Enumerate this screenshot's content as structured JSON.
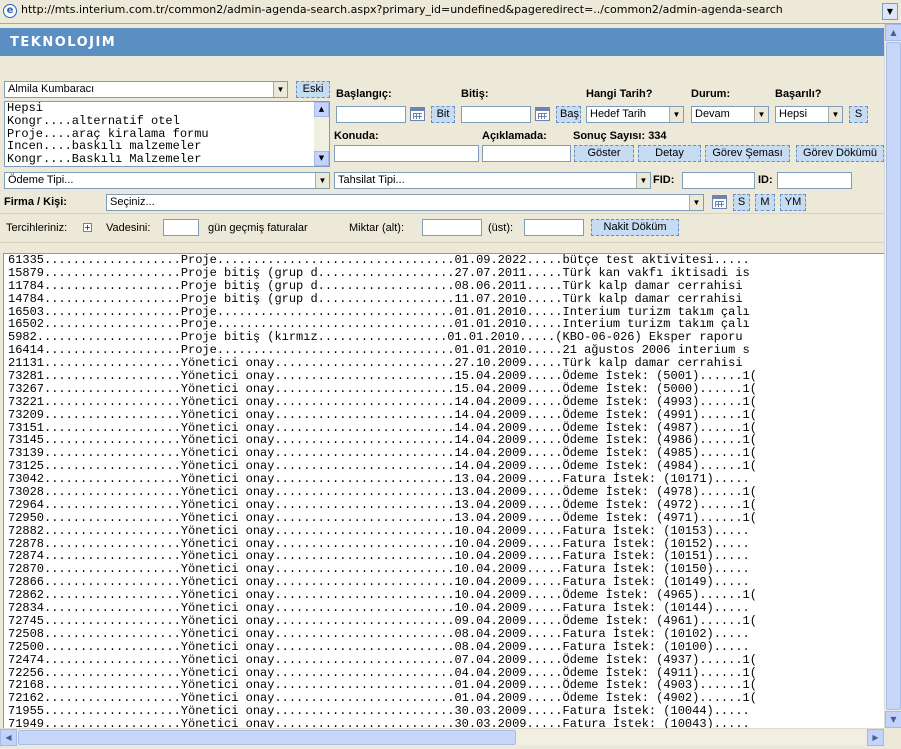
{
  "browser": {
    "url": "http://mts.interium.com.tr/common2/admin-agenda-search.aspx?primary_id=undefined&pageredirect=../common2/admin-agenda-search"
  },
  "brand": {
    "logo": "TEKNOLOJIM"
  },
  "filters": {
    "user_select": "Almila Kumbaracı",
    "eski_button": "Eski",
    "list_items": [
      "Hepsi",
      "Kongr....alternatif otel",
      "Proje....araç kiralama formu",
      "Incen....baskılı malzemeler",
      "Kongr....Baskılı Malzemeler"
    ],
    "baslangic_label": "Başlangıç:",
    "bit_button": "Bit",
    "bitis_label": "Bitiş:",
    "bas_button": "Baş",
    "hangi_tarih_label": "Hangi Tarih?",
    "hangi_tarih_value": "Hedef Tarih",
    "durum_label": "Durum:",
    "durum_value": "Devam",
    "basarili_label": "Başarılı?",
    "basarili_value": "Hepsi",
    "s_button": "S",
    "konuda_label": "Konuda:",
    "aciklamada_label": "Açıklamada:",
    "sonuc_label": "Sonuç Sayısı: 334",
    "goster_button": "Göster",
    "detay_button": "Detay",
    "gorev_semasi_button": "Görev Şeması",
    "gorev_dokumu_button": "Görev Dökümü",
    "odeme_tipi": "Ödeme Tipi...",
    "tahsilat_tipi": "Tahsilat Tipi...",
    "fid_label": "FID:",
    "id_label": "ID:",
    "firma_label": "Firma / Kişi:",
    "firma_value": "Seçiniz...",
    "s2_button": "S",
    "m_button": "M",
    "ym_button": "YM",
    "tercihleriniz_label": "Tercihleriniz:",
    "vadesini_label": "Vadesini:",
    "gecmis_label": "gün geçmiş faturalar",
    "miktar_alt_label": "Miktar (alt):",
    "ust_label": "(üst):",
    "nakit_button": "Nakit Döküm"
  },
  "results": [
    "61335...................Proje.................................01.09.2022.....bütçe test aktivitesi.....",
    "15879...................Proje bitiş (grup d...................27.07.2011.....Türk kan vakfı iktisadi is",
    "11784...................Proje bitiş (grup d...................08.06.2011.....Türk kalp damar cerrahisi",
    "14784...................Proje bitiş (grup d...................11.07.2010.....Türk kalp damar cerrahisi",
    "16503...................Proje.................................01.01.2010.....Interium turizm takım çalı",
    "16502...................Proje.................................01.01.2010.....Interium turizm takım çalı",
    "5982....................Proje bitiş (kırmız..................01.01.2010.....(KBO-06-026) Eksper raporu",
    "16414...................Proje.................................01.01.2010.....21 ağustos 2006 interium s",
    "21131...................Yönetici onay.........................27.10.2009.....Türk kalp damar cerrahisi",
    "73281...................Yönetici onay.........................15.04.2009.....Ödeme İstek: (5001)......1(",
    "73267...................Yönetici onay.........................15.04.2009.....Ödeme İstek: (5000)......1(",
    "73221...................Yönetici onay.........................14.04.2009.....Ödeme İstek: (4993)......1(",
    "73209...................Yönetici onay.........................14.04.2009.....Ödeme İstek: (4991)......1(",
    "73151...................Yönetici onay.........................14.04.2009.....Ödeme İstek: (4987)......1(",
    "73145...................Yönetici onay.........................14.04.2009.....Ödeme İstek: (4986)......1(",
    "73139...................Yönetici onay.........................14.04.2009.....Ödeme İstek: (4985)......1(",
    "73125...................Yönetici onay.........................14.04.2009.....Ödeme İstek: (4984)......1(",
    "73042...................Yönetici onay.........................13.04.2009.....Fatura İstek: (10171).....",
    "73028...................Yönetici onay.........................13.04.2009.....Ödeme İstek: (4978)......1(",
    "72964...................Yönetici onay.........................13.04.2009.....Ödeme İstek: (4972)......1(",
    "72950...................Yönetici onay.........................13.04.2009.....Ödeme İstek: (4971)......1(",
    "72882...................Yönetici onay.........................10.04.2009.....Fatura İstek: (10153).....",
    "72878...................Yönetici onay.........................10.04.2009.....Fatura İstek: (10152).....",
    "72874...................Yönetici onay.........................10.04.2009.....Fatura İstek: (10151).....",
    "72870...................Yönetici onay.........................10.04.2009.....Fatura İstek: (10150).....",
    "72866...................Yönetici onay.........................10.04.2009.....Fatura İstek: (10149).....",
    "72862...................Yönetici onay.........................10.04.2009.....Ödeme İstek: (4965)......1(",
    "72834...................Yönetici onay.........................10.04.2009.....Fatura İstek: (10144).....",
    "72745...................Yönetici onay.........................09.04.2009.....Ödeme İstek: (4961)......1(",
    "72508...................Yönetici onay.........................08.04.2009.....Fatura İstek: (10102).....",
    "72500...................Yönetici onay.........................08.04.2009.....Fatura İstek: (10100).....",
    "72474...................Yönetici onay.........................07.04.2009.....Ödeme İstek: (4937)......1(",
    "72256...................Yönetici onay.........................04.04.2009.....Ödeme İstek: (4911)......1(",
    "72168...................Yönetici onay.........................01.04.2009.....Ödeme İstek: (4903)......1(",
    "72162...................Yönetici onay.........................01.04.2009.....Ödeme İstek: (4902)......1(",
    "71955...................Yönetici onay.........................30.03.2009.....Fatura İstek: (10044).....",
    "71949...................Yönetici onay.........................30.03.2009.....Fatura İstek: (10043)....."
  ]
}
